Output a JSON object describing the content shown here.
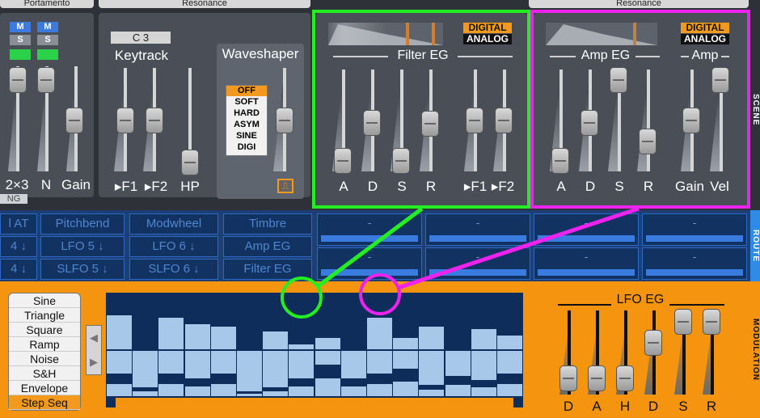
{
  "top_labels": {
    "portamento": "Portamento",
    "resonance1": "Resonance",
    "resonance2": "Resonance"
  },
  "side_tabs": {
    "scene": "SCENE",
    "route": "ROUTE",
    "modulation": "MODULATION"
  },
  "osc_mix": {
    "m1": "M",
    "s1": "S",
    "m2": "M",
    "s2": "S",
    "labels": [
      "2×3",
      "N",
      "Gain"
    ],
    "ng": "NG"
  },
  "keytrack": {
    "note": "C 3",
    "title": "Keytrack",
    "labels": [
      "▸F1",
      "▸F2",
      "HP"
    ]
  },
  "waveshaper": {
    "title": "Waveshaper",
    "options": [
      "OFF",
      "SOFT",
      "HARD",
      "ASYM",
      "SINE",
      "DIGI"
    ],
    "selected": "OFF"
  },
  "filter_eg": {
    "title": "Filter EG",
    "digital": "DIGITAL",
    "analog": "ANALOG",
    "labels": [
      "A",
      "D",
      "S",
      "R",
      "▸F1",
      "▸F2"
    ]
  },
  "amp_eg": {
    "title": "Amp EG",
    "amp": "Amp",
    "digital": "DIGITAL",
    "analog": "ANALOG",
    "labels": [
      "A",
      "D",
      "S",
      "R",
      "Gain",
      "Vel"
    ]
  },
  "route": {
    "row1": [
      "l AT",
      "Pitchbend",
      "Modwheel",
      "Timbre"
    ],
    "row2": [
      "4",
      "LFO 5",
      "LFO 6",
      "Amp EG"
    ],
    "row3": [
      "4",
      "SLFO 5",
      "SLFO 6",
      "Filter EG"
    ],
    "slots": [
      "-",
      "-",
      "-",
      "-",
      "-",
      "-",
      "-",
      "-"
    ]
  },
  "lfo_shapes": {
    "items": [
      "Sine",
      "Triangle",
      "Square",
      "Ramp",
      "Noise",
      "S&H",
      "Envelope",
      "Step Seq"
    ],
    "selected": "Step Seq"
  },
  "step_seq": {
    "steps": [
      0.75,
      1.0,
      0.7,
      0.55,
      0.5,
      0.9,
      0.4,
      0.1,
      0.25,
      0.9,
      0.7,
      0.25,
      0.5,
      0.85,
      0.45,
      0.3
    ],
    "steps_low": [
      0.5,
      0.2,
      0.5,
      0.4,
      0.5,
      0.1,
      0.2,
      0.4,
      0.7,
      0.4,
      0.5,
      0.6,
      0.25,
      0.45,
      0.35,
      0.5
    ]
  },
  "lfo_eg": {
    "title": "LFO EG",
    "labels": [
      "D",
      "A",
      "H",
      "D",
      "S",
      "R"
    ]
  },
  "colors": {
    "filter_highlight": "#22ee22",
    "amp_highlight": "#ee22ee",
    "accent": "#f5940f",
    "route_blue": "#2a6ac5"
  }
}
